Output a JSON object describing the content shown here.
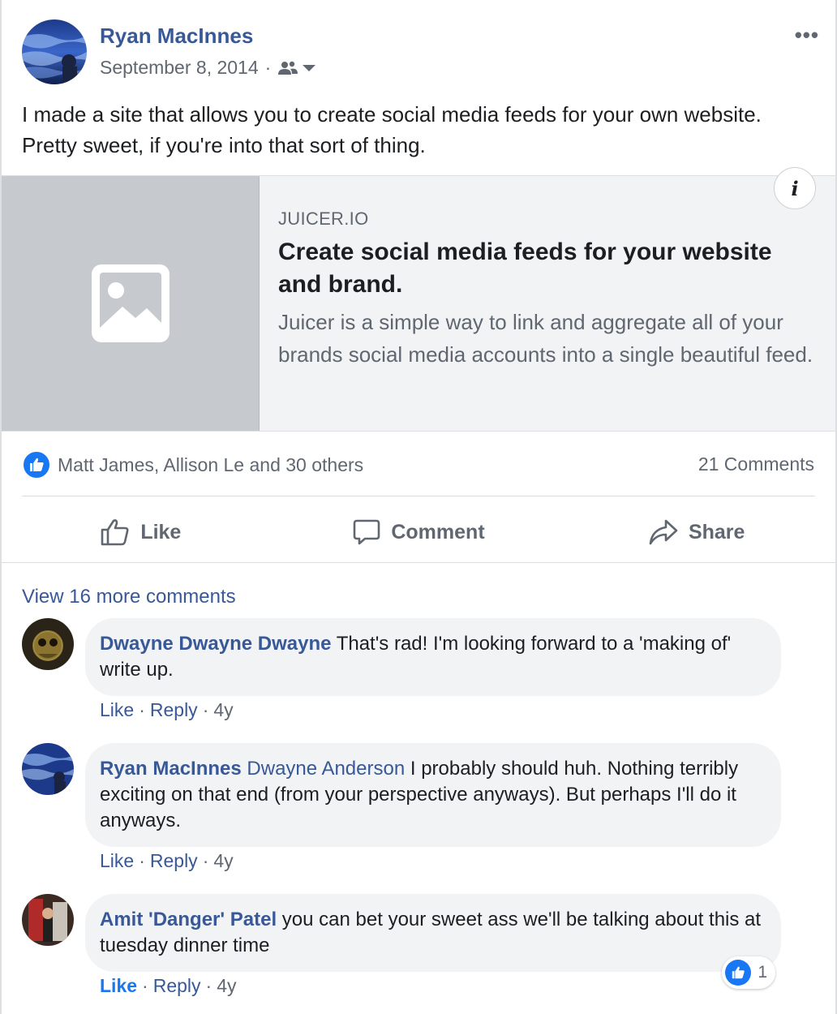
{
  "post": {
    "author": "Ryan MacInnes",
    "date": "September 8, 2014",
    "separator": "·",
    "audience_icon": "friends-icon",
    "more_icon": "more-options-icon",
    "more_glyph": "•••",
    "text": "I made a site that allows you to create social media feeds for your own website. Pretty sweet, if you're into that sort of thing."
  },
  "link_preview": {
    "domain": "JUICER.IO",
    "title": "Create social media feeds for your website and brand.",
    "description": "Juicer is a simple way to link and aggregate all of your brands social media accounts into a single beautiful feed.",
    "info_glyph": "i",
    "image_icon": "image-placeholder-icon"
  },
  "stats": {
    "reactions_text": "Matt James, Allison Le and 30 others",
    "comments_text": "21 Comments"
  },
  "actions": {
    "like": "Like",
    "comment": "Comment",
    "share": "Share"
  },
  "comments_section": {
    "view_more": "View 16 more comments",
    "items": [
      {
        "name": "Dwayne Dwayne Dwayne",
        "tag": "",
        "text": " That's rad! I'm looking forward to a 'making of' write up.",
        "like": "Like",
        "reply": "Reply",
        "time": "4y"
      },
      {
        "name": "Ryan MacInnes",
        "tag": " Dwayne Anderson",
        "text": " I probably should huh. Nothing terribly exciting on that end (from your perspective anyways). But perhaps I'll do it anyways.",
        "like": "Like",
        "reply": "Reply",
        "time": "4y"
      },
      {
        "name": "Amit 'Danger' Patel",
        "tag": "",
        "text": " you can bet your sweet ass we'll be talking about this at tuesday dinner time",
        "like": "Like",
        "reply": "Reply",
        "time": "4y",
        "reaction_count": "1"
      }
    ]
  },
  "colors": {
    "link_blue": "#385898",
    "like_blue": "#1877f2",
    "meta_gray": "#606770",
    "bubble_bg": "#f2f3f5"
  }
}
